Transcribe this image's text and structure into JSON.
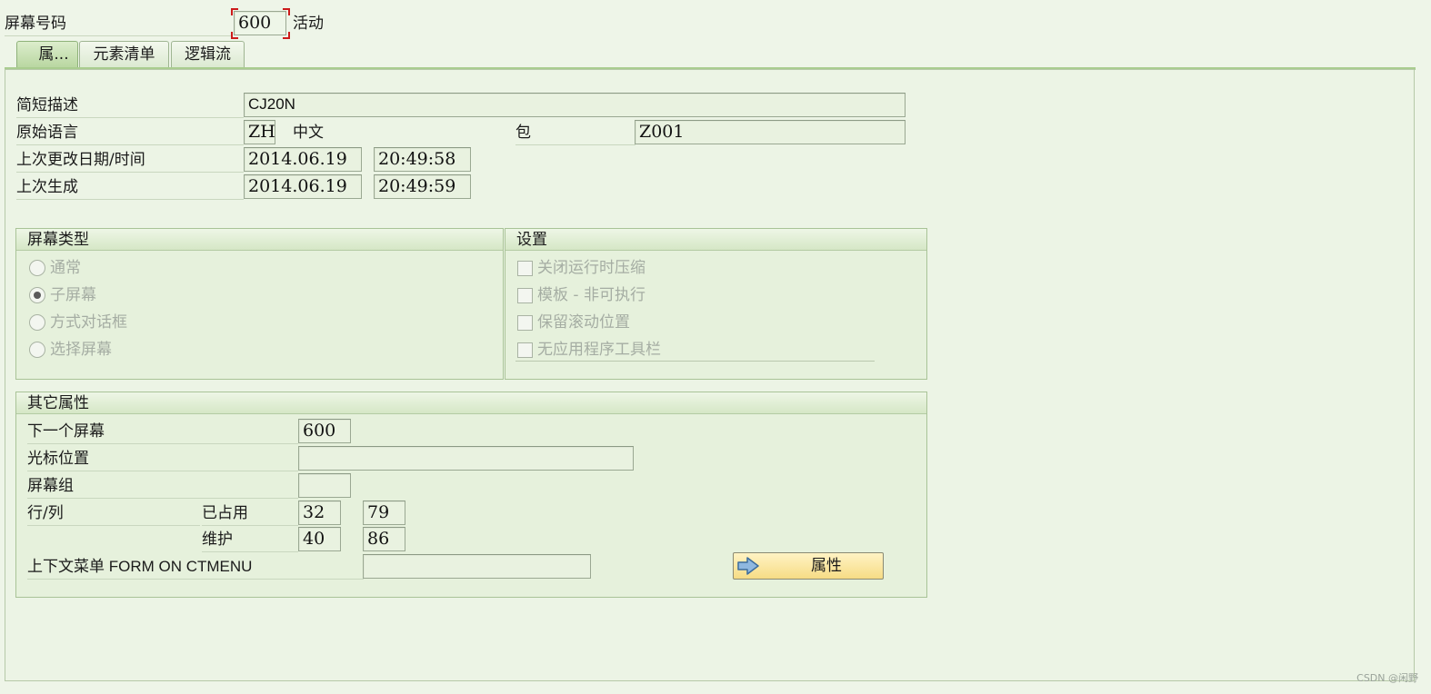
{
  "header": {
    "screen_number_label": "屏幕号码",
    "screen_number": "600",
    "status": "活动"
  },
  "tabs": [
    {
      "label": "属...",
      "active": true
    },
    {
      "label": "元素清单",
      "active": false
    },
    {
      "label": "逻辑流",
      "active": false
    }
  ],
  "attributes": {
    "short_desc_label": "简短描述",
    "short_desc": "CJ20N",
    "orig_lang_label": "原始语言",
    "orig_lang_code": "ZH",
    "orig_lang_name": "中文",
    "package_label": "包",
    "package": "Z001",
    "last_changed_label": "上次更改日期/时间",
    "last_changed_date": "2014.06.19",
    "last_changed_time": "20:49:58",
    "last_generated_label": "上次生成",
    "last_generated_date": "2014.06.19",
    "last_generated_time": "20:49:59"
  },
  "screen_type": {
    "title": "屏幕类型",
    "options": [
      "通常",
      "子屏幕",
      "方式对话框",
      "选择屏幕"
    ],
    "selected": "子屏幕"
  },
  "settings": {
    "title": "设置",
    "options": [
      "关闭运行时压缩",
      "模板 - 非可执行",
      "保留滚动位置",
      "无应用程序工具栏"
    ]
  },
  "other": {
    "title": "其它属性",
    "next_screen_label": "下一个屏幕",
    "next_screen": "600",
    "cursor_label": "光标位置",
    "cursor_value": "",
    "group_label": "屏幕组",
    "group_value": "",
    "rowcol_label": "行/列",
    "occupied_label": "已占用",
    "occupied_rows": "32",
    "occupied_cols": "79",
    "maintain_label": "维护",
    "maintain_rows": "40",
    "maintain_cols": "86",
    "context_menu_label": "上下文菜单 FORM ON CTMENU",
    "context_menu_value": ""
  },
  "button": {
    "label": "属性"
  },
  "watermark": "CSDN @闲野",
  "colors": {
    "panel_bg": "#eef5e8",
    "group_bg": "#e6f1dc",
    "tab_active": "#b8d6a0",
    "button": "#f6dc85",
    "cursor_mark": "#cc1b1b"
  }
}
